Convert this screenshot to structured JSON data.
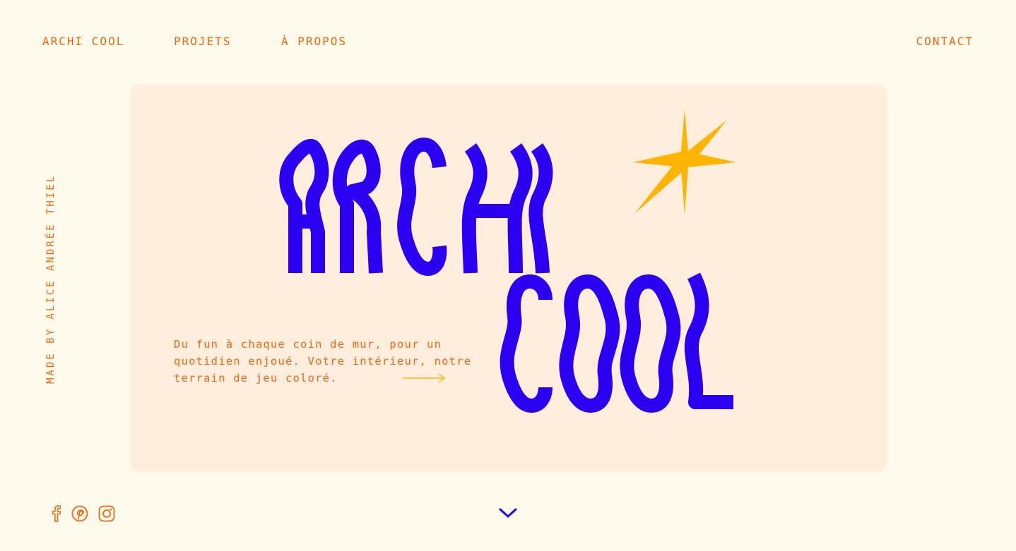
{
  "nav": {
    "brand": "ARCHI COOL",
    "projets": "PROJETS",
    "apropos": "À PROPOS",
    "contact": "CONTACT"
  },
  "credit": "MADE BY ALICE ANDRÉE THIEL",
  "hero": {
    "word1": "ARCHI",
    "word2": "COOL",
    "tagline": "Du fun à chaque coin de mur, pour un quotidien enjoué. Votre intérieur, notre terrain de jeu coloré."
  },
  "colors": {
    "background": "#FFFAEC",
    "card": "#FFEDDE",
    "accent_orange": "#EE6A10",
    "accent_blue": "#2B00F0",
    "star_yellow": "#FFB400"
  },
  "icons": {
    "social": [
      "facebook-icon",
      "pinterest-icon",
      "instagram-icon"
    ],
    "scroll": "chevron-down-icon",
    "tagline_arrow": "arrow-right-icon",
    "decoration": "sparkle-star-icon"
  }
}
